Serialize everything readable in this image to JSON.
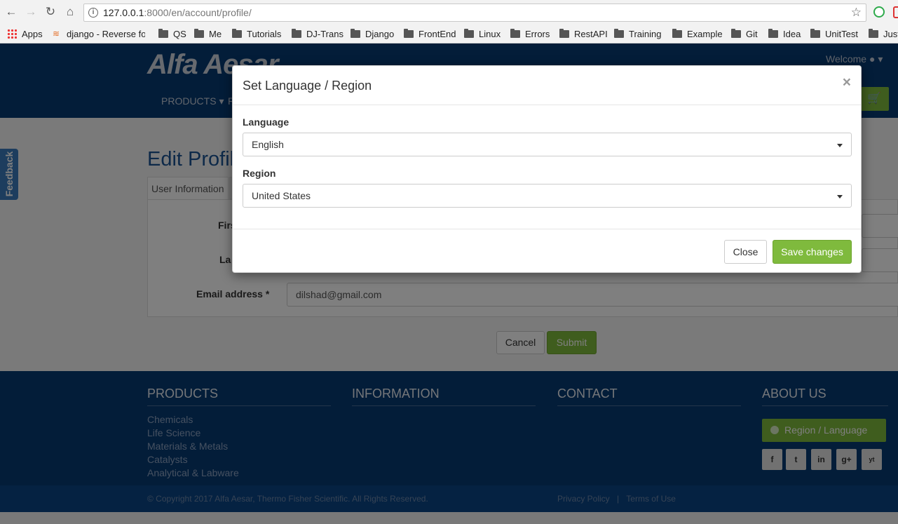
{
  "browser": {
    "url_host": "127.0.0.1",
    "url_rest": ":8000/en/account/profile/",
    "bookmarks": [
      "Apps",
      "django - Reverse for",
      "QS",
      "Me",
      "Tutorials",
      "DJ-Trans",
      "Django",
      "FrontEnd",
      "Linux",
      "Errors",
      "RestAPI",
      "Training",
      "Example",
      "Git",
      "Idea",
      "UnitTest",
      "Just"
    ]
  },
  "header": {
    "logo": "Alfa Aesar",
    "welcome": "Welcome",
    "nav_products": "PRODUCTS",
    "nav_r": "R"
  },
  "page": {
    "title": "Edit Profile",
    "tab_user_info": "User Information",
    "first_label": "Firs",
    "last_label": "La",
    "email_label": "Email address *",
    "email_value": "dilshad@gmail.com",
    "cancel": "Cancel",
    "submit": "Submit",
    "feedback": "Feedback"
  },
  "modal": {
    "title": "Set Language / Region",
    "close_x": "×",
    "language_label": "Language",
    "language_value": "English",
    "region_label": "Region",
    "region_value": "United States",
    "close_btn": "Close",
    "save_btn": "Save changes"
  },
  "footer": {
    "products_head": "PRODUCTS",
    "products": [
      "Chemicals",
      "Life Science",
      "Materials & Metals",
      "Catalysts",
      "Analytical & Labware"
    ],
    "information_head": "INFORMATION",
    "contact_head": "CONTACT",
    "about_head": "ABOUT US",
    "region_btn": "Region / Language",
    "social": [
      "f",
      "t",
      "in",
      "g+",
      "yt"
    ],
    "copyright": "© Copyright 2017 Alfa Aesar, Thermo Fisher Scientific. All Rights Reserved.",
    "privacy": "Privacy Policy",
    "sep": "|",
    "terms": "Terms of Use"
  }
}
